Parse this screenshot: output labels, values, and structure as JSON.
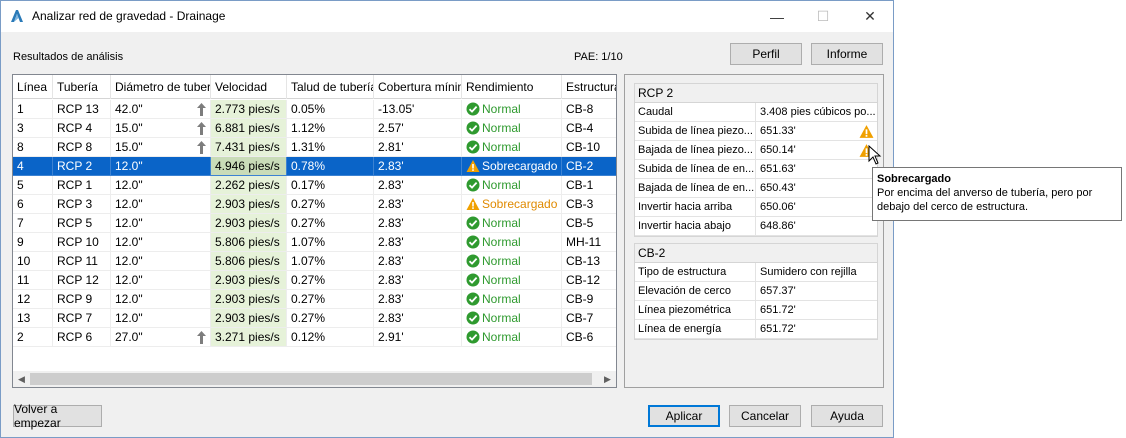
{
  "window": {
    "title": "Analizar red de gravedad - Drainage",
    "min": "—",
    "max": "☐",
    "close": "✕"
  },
  "labels": {
    "results": "Resultados de análisis",
    "pae": "PAE:  1/10"
  },
  "buttons": {
    "profile": "Perfil",
    "report": "Informe",
    "reset": "Volver a empezar",
    "apply": "Aplicar",
    "cancel": "Cancelar",
    "help": "Ayuda"
  },
  "table": {
    "headers": [
      "Línea",
      "Tubería",
      "Diámetro de tubería",
      "Velocidad",
      "Talud de tubería",
      "Cobertura mínima",
      "Rendimiento",
      "Estructura"
    ],
    "rows": [
      {
        "line": "1",
        "pipe": "RCP 13",
        "diam": "42.0\"",
        "up": true,
        "vel": "2.773 pies/s",
        "slope": "0.05%",
        "cover": "-13.05'",
        "status": "Normal",
        "warn": false,
        "struct": "CB-8"
      },
      {
        "line": "3",
        "pipe": "RCP 4",
        "diam": "15.0\"",
        "up": true,
        "vel": "6.881 pies/s",
        "slope": "1.12%",
        "cover": "2.57'",
        "status": "Normal",
        "warn": false,
        "struct": "CB-4"
      },
      {
        "line": "8",
        "pipe": "RCP 8",
        "diam": "15.0\"",
        "up": true,
        "vel": "7.431 pies/s",
        "slope": "1.31%",
        "cover": "2.81'",
        "status": "Normal",
        "warn": false,
        "struct": "CB-10"
      },
      {
        "line": "4",
        "pipe": "RCP 2",
        "diam": "12.0\"",
        "up": false,
        "vel": "4.946 pies/s",
        "slope": "0.78%",
        "cover": "2.83'",
        "status": "Sobrecargado",
        "warn": true,
        "struct": "CB-2"
      },
      {
        "line": "5",
        "pipe": "RCP 1",
        "diam": "12.0\"",
        "up": false,
        "vel": "2.262 pies/s",
        "slope": "0.17%",
        "cover": "2.83'",
        "status": "Normal",
        "warn": false,
        "struct": "CB-1"
      },
      {
        "line": "6",
        "pipe": "RCP 3",
        "diam": "12.0\"",
        "up": false,
        "vel": "2.903 pies/s",
        "slope": "0.27%",
        "cover": "2.83'",
        "status": "Sobrecargado",
        "warn": true,
        "struct": "CB-3"
      },
      {
        "line": "7",
        "pipe": "RCP 5",
        "diam": "12.0\"",
        "up": false,
        "vel": "2.903 pies/s",
        "slope": "0.27%",
        "cover": "2.83'",
        "status": "Normal",
        "warn": false,
        "struct": "CB-5"
      },
      {
        "line": "9",
        "pipe": "RCP 10",
        "diam": "12.0\"",
        "up": false,
        "vel": "5.806 pies/s",
        "slope": "1.07%",
        "cover": "2.83'",
        "status": "Normal",
        "warn": false,
        "struct": "MH-11"
      },
      {
        "line": "10",
        "pipe": "RCP 11",
        "diam": "12.0\"",
        "up": false,
        "vel": "5.806 pies/s",
        "slope": "1.07%",
        "cover": "2.83'",
        "status": "Normal",
        "warn": false,
        "struct": "CB-13"
      },
      {
        "line": "11",
        "pipe": "RCP 12",
        "diam": "12.0\"",
        "up": false,
        "vel": "2.903 pies/s",
        "slope": "0.27%",
        "cover": "2.83'",
        "status": "Normal",
        "warn": false,
        "struct": "CB-12"
      },
      {
        "line": "12",
        "pipe": "RCP 9",
        "diam": "12.0\"",
        "up": false,
        "vel": "2.903 pies/s",
        "slope": "0.27%",
        "cover": "2.83'",
        "status": "Normal",
        "warn": false,
        "struct": "CB-9"
      },
      {
        "line": "13",
        "pipe": "RCP 7",
        "diam": "12.0\"",
        "up": false,
        "vel": "2.903 pies/s",
        "slope": "0.27%",
        "cover": "2.83'",
        "status": "Normal",
        "warn": false,
        "struct": "CB-7"
      },
      {
        "line": "2",
        "pipe": "RCP 6",
        "diam": "27.0\"",
        "up": true,
        "vel": "3.271 pies/s",
        "slope": "0.12%",
        "cover": "2.91'",
        "status": "Normal",
        "warn": false,
        "struct": "CB-6"
      }
    ],
    "selected_index": 3
  },
  "pipe_props": {
    "title": "RCP 2",
    "rows": [
      {
        "k": "Caudal",
        "v": "3.408 pies cúbicos po...",
        "warn": false
      },
      {
        "k": "Subida de línea piezo...",
        "v": "651.33'",
        "warn": true
      },
      {
        "k": "Bajada de línea piezo...",
        "v": "650.14'",
        "warn": true
      },
      {
        "k": "Subida de línea de en...",
        "v": "651.63'",
        "warn": false
      },
      {
        "k": "Bajada de línea de en...",
        "v": "650.43'",
        "warn": false
      },
      {
        "k": "Invertir hacia arriba",
        "v": "650.06'",
        "warn": false
      },
      {
        "k": "Invertir hacia abajo",
        "v": "648.86'",
        "warn": false
      }
    ]
  },
  "struct_props": {
    "title": "CB-2",
    "rows": [
      {
        "k": "Tipo de estructura",
        "v": "Sumidero con rejilla"
      },
      {
        "k": "Elevación de cerco",
        "v": "657.37'"
      },
      {
        "k": "Línea piezométrica",
        "v": "651.72'"
      },
      {
        "k": "Línea de energía",
        "v": "651.72'"
      }
    ]
  },
  "tooltip": {
    "title": "Sobrecargado",
    "text": "Por encima del anverso de tubería, pero por debajo del cerco de estructura."
  },
  "colors": {
    "selection": "#0a64c8",
    "velocity_bg": "#e6f2d9",
    "ok": "#2f9a2f",
    "warn": "#e08a00"
  },
  "icons": {
    "app": "autodesk-logo-icon",
    "ok": "check-circle-icon",
    "warn": "warning-triangle-icon",
    "up": "arrow-up-icon"
  }
}
